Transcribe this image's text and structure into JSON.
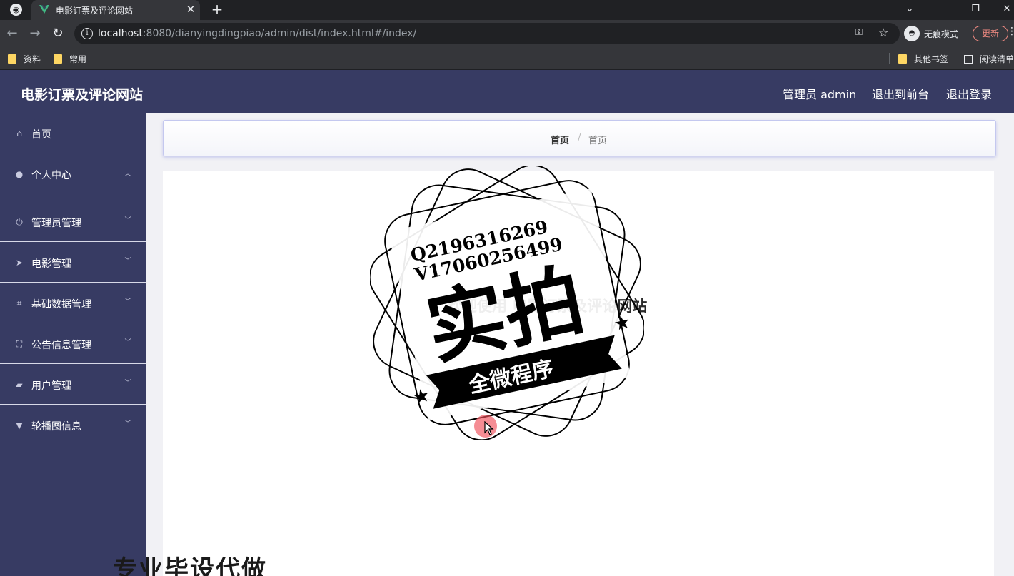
{
  "browser": {
    "tab_title": "电影订票及评论网站",
    "url_host": "localhost",
    "url_rest": ":8080/dianyingdingpiao/admin/dist/index.html#/index/",
    "incognito_label": "无痕模式",
    "update_label": "更新",
    "bookmarks": [
      "资料",
      "常用"
    ],
    "other_bookmarks": "其他书签",
    "reading_list": "阅读清单"
  },
  "header": {
    "title": "电影订票及评论网站",
    "admin_label": "管理员 admin",
    "exit_front": "退出到前台",
    "logout": "退出登录",
    "bg_color": "#373b63"
  },
  "sidebar": {
    "items": [
      {
        "label": "首页",
        "icon": "home-icon"
      },
      {
        "label": "个人中心",
        "icon": "user-icon",
        "expanded": true
      },
      {
        "label": "管理员管理",
        "icon": "power-icon"
      },
      {
        "label": "电影管理",
        "icon": "send-icon"
      },
      {
        "label": "基础数据管理",
        "icon": "crop-icon"
      },
      {
        "label": "公告信息管理",
        "icon": "fullscreen-icon"
      },
      {
        "label": "用户管理",
        "icon": "wallet-icon"
      },
      {
        "label": "轮播图信息",
        "icon": "paint-icon"
      }
    ]
  },
  "breadcrumb": {
    "home": "首页",
    "separator": "/",
    "current": "首页"
  },
  "main": {
    "welcome": "欢迎使用 电影订票及评论网站"
  },
  "overlay": {
    "stamp_contact_q": "Q2196316269",
    "stamp_contact_v": "V17060256499",
    "stamp_main": "实拍",
    "stamp_banner": "全微程序",
    "bottom_text": "专业毕设代做"
  }
}
